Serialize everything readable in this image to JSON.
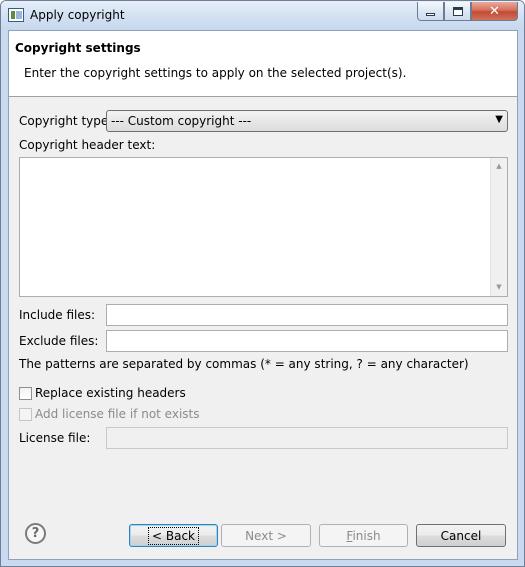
{
  "window": {
    "title": "Apply copyright",
    "controls": {
      "minimize_icon": "minimize-icon",
      "maximize_icon": "maximize-icon",
      "close_glyph": "✕"
    }
  },
  "header": {
    "title": "Copyright settings",
    "description": "Enter the copyright settings to apply on the selected project(s)."
  },
  "form": {
    "copyright_type_label": "Copyright type:",
    "copyright_type_value": "--- Custom copyright ---",
    "header_text_label": "Copyright header text:",
    "header_text_value": "",
    "include_files_label": "Include files:",
    "include_files_value": "",
    "exclude_files_label": "Exclude files:",
    "exclude_files_value": "",
    "patterns_hint": "The patterns are separated by commas (* = any string, ? = any character)",
    "replace_headers_label": "Replace existing headers",
    "replace_headers_checked": false,
    "add_license_label": "Add license file if not exists",
    "add_license_checked": false,
    "license_file_label": "License file:",
    "license_file_value": ""
  },
  "footer": {
    "help_glyph": "?",
    "back_label": "< Back",
    "next_label": "Next >",
    "finish_label": "Finish",
    "cancel_label": "Cancel"
  }
}
